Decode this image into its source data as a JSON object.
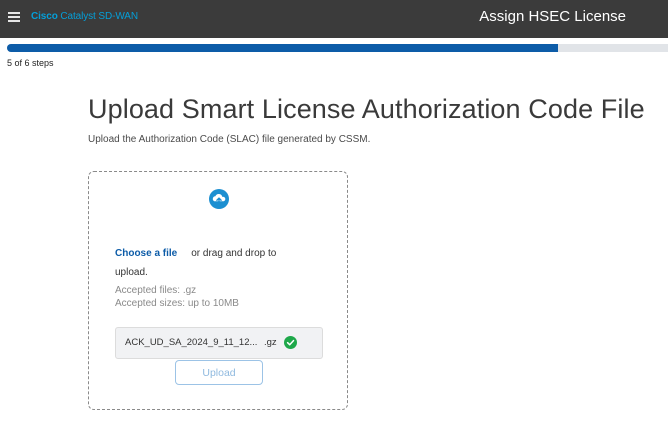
{
  "header": {
    "brand_bold": "Cisco",
    "brand_rest": " Catalyst SD-WAN",
    "window_title": "Assign HSEC License"
  },
  "progress": {
    "current_step": 5,
    "total_steps": 6,
    "fraction": 0.8333,
    "label": "5 of 6 steps"
  },
  "main": {
    "title": "Upload Smart License Authorization Code File",
    "subtitle": "Upload the Authorization Code (SLAC) file generated by CSSM."
  },
  "dropzone": {
    "choose_link": "Choose a file",
    "drag_text": "or drag and drop to",
    "drag_text2": "upload.",
    "accepted_files": "Accepted files: .gz",
    "accepted_sizes": "Accepted sizes: up to 10MB",
    "file_name": "ACK_UD_SA_2024_9_11_12...",
    "file_ext": ".gz",
    "upload_label": "Upload"
  },
  "icons": {
    "menu": "hamburger-menu-icon",
    "upload": "cloud-upload-icon",
    "status": "check-circle-icon"
  },
  "colors": {
    "header_bg": "#3b3b3b",
    "brand": "#049fd9",
    "progress": "#0d5ca8",
    "link": "#0d5ca8",
    "success": "#1ea84a"
  }
}
